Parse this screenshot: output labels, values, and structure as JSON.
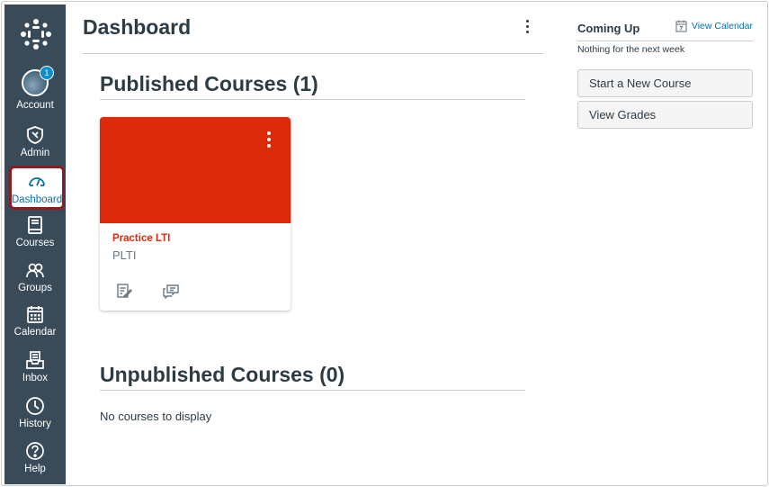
{
  "nav": {
    "items": [
      {
        "key": "account",
        "label": "Account",
        "icon": "avatar",
        "badge": "1"
      },
      {
        "key": "admin",
        "label": "Admin",
        "icon": "shield-icon"
      },
      {
        "key": "dashboard",
        "label": "Dashboard",
        "icon": "speedometer-icon",
        "active": true
      },
      {
        "key": "courses",
        "label": "Courses",
        "icon": "book-icon"
      },
      {
        "key": "groups",
        "label": "Groups",
        "icon": "people-icon"
      },
      {
        "key": "calendar",
        "label": "Calendar",
        "icon": "calendar-icon"
      },
      {
        "key": "inbox",
        "label": "Inbox",
        "icon": "inbox-icon"
      },
      {
        "key": "history",
        "label": "History",
        "icon": "clock-icon"
      },
      {
        "key": "help",
        "label": "Help",
        "icon": "question-icon"
      }
    ]
  },
  "header": {
    "title": "Dashboard"
  },
  "published": {
    "title": "Published Courses (1)",
    "courses": [
      {
        "name": "Practice LTI",
        "code": "PLTI",
        "color": "#dc2a0a"
      }
    ]
  },
  "unpublished": {
    "title": "Unpublished Courses (0)",
    "empty_message": "No courses to display"
  },
  "sidebar": {
    "coming_up": "Coming Up",
    "view_calendar": "View Calendar",
    "nothing_message": "Nothing for the next week",
    "start_course_label": "Start a New Course",
    "view_grades_label": "View Grades"
  },
  "colors": {
    "nav_bg": "#394b58",
    "active_border": "#8b1c22",
    "link": "#0770a3",
    "badge": "#0b8ecf"
  }
}
